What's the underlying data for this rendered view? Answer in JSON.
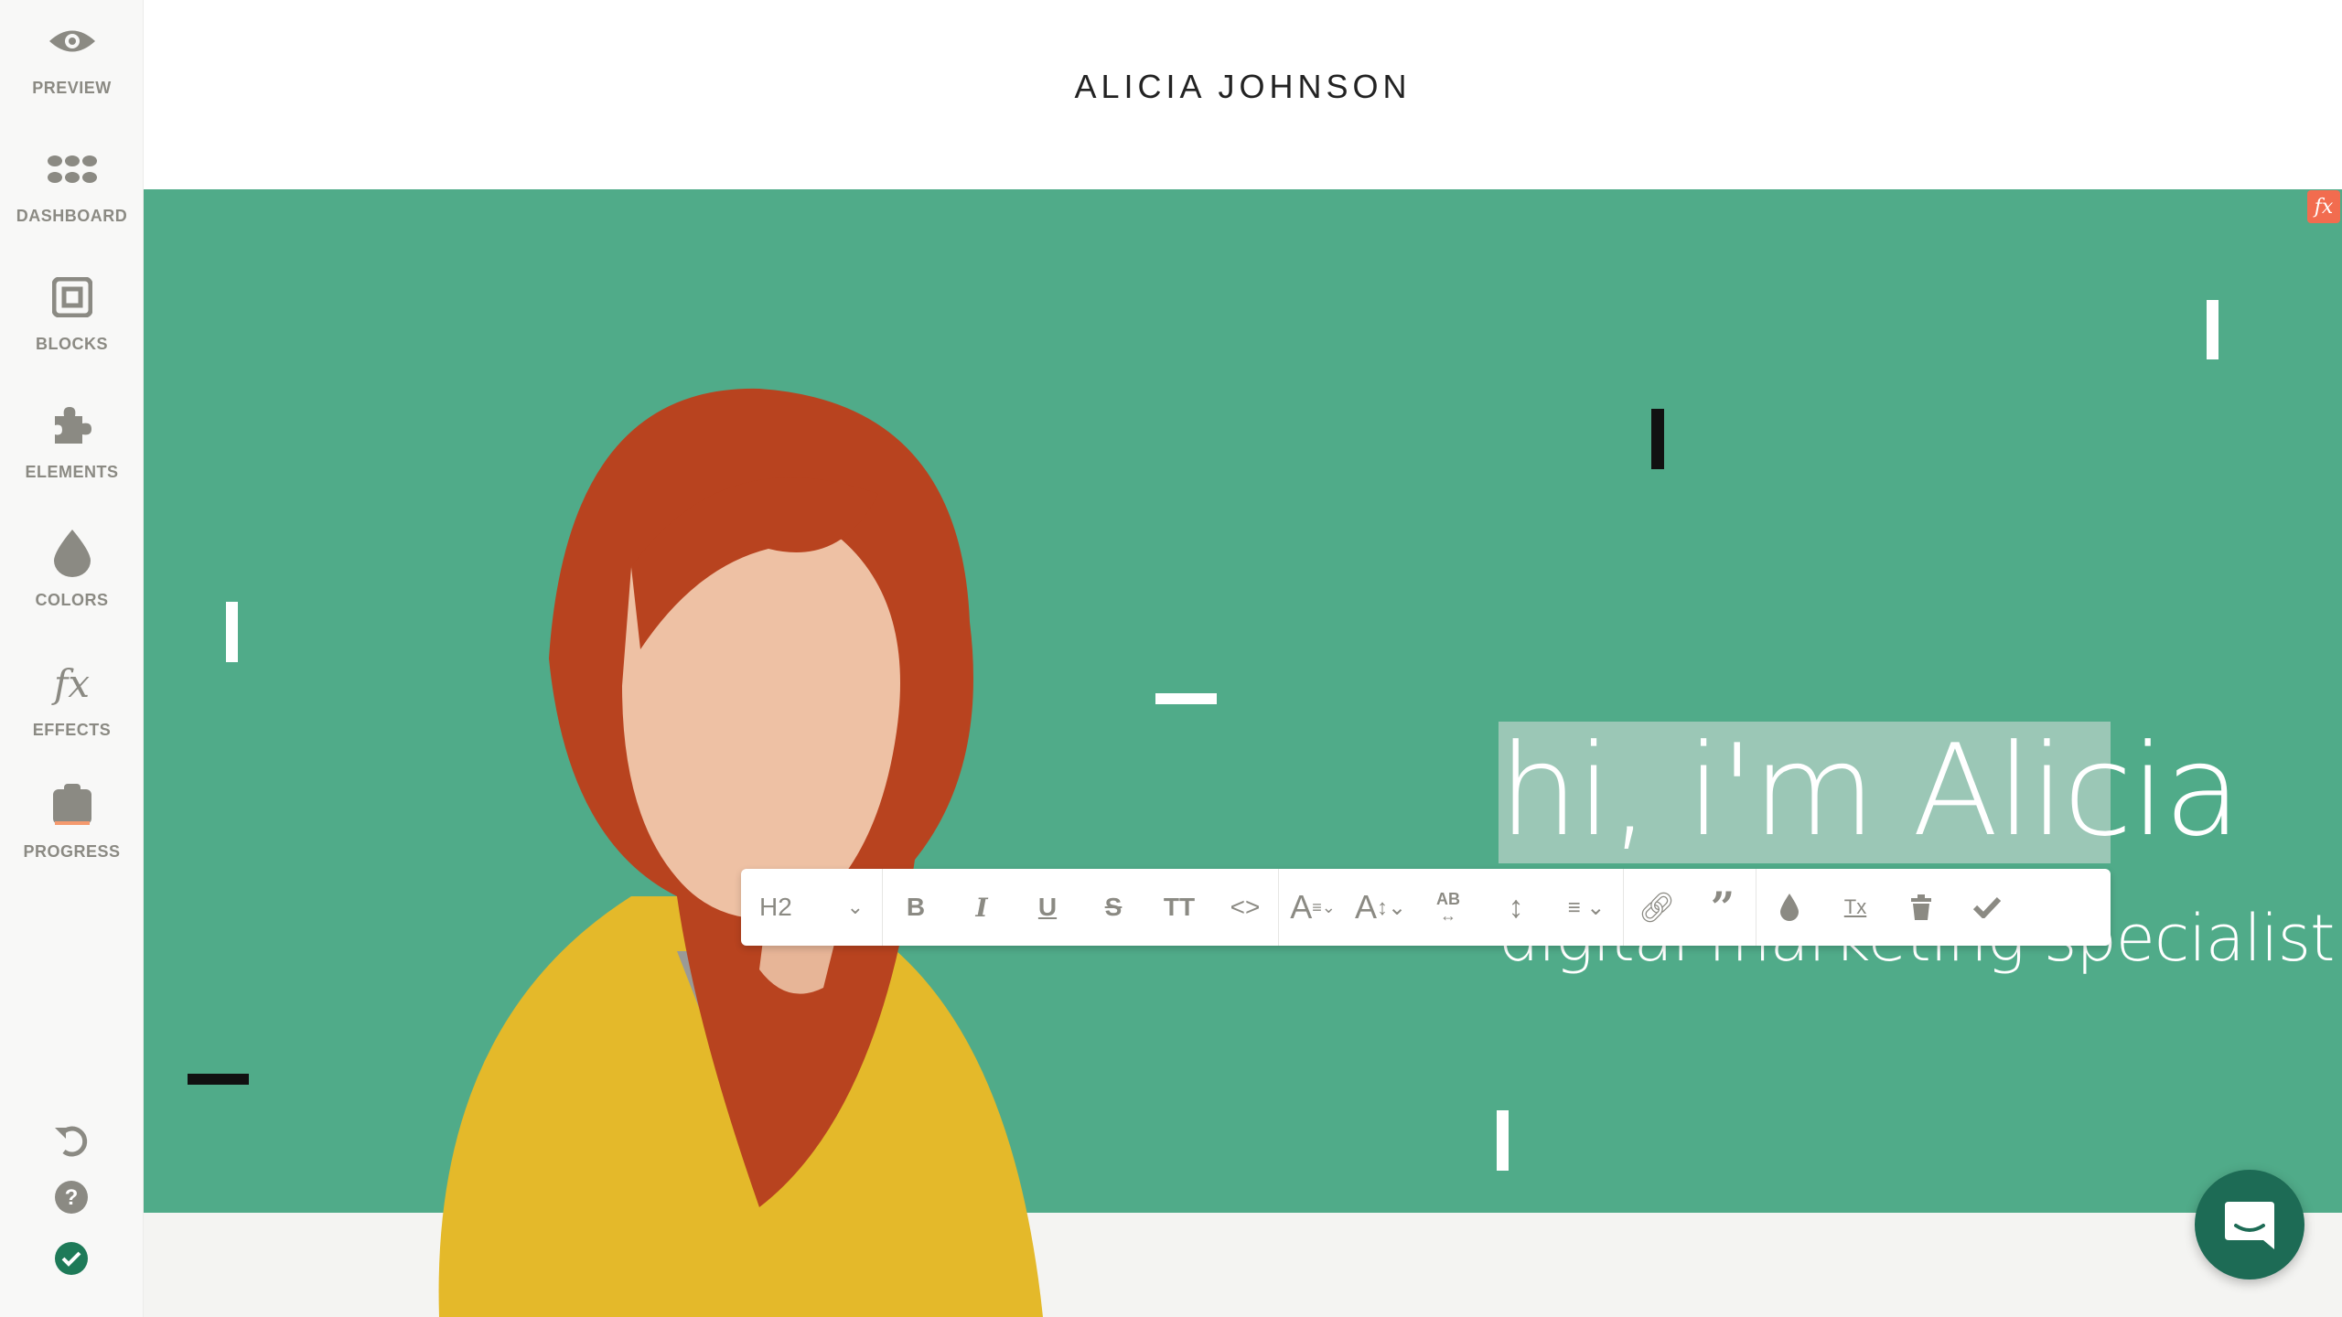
{
  "sidebar": {
    "items": [
      {
        "label": "PREVIEW",
        "icon": "eye-icon"
      },
      {
        "label": "DASHBOARD",
        "icon": "dots-grid-icon"
      },
      {
        "label": "BLOCKS",
        "icon": "block-square-icon"
      },
      {
        "label": "ELEMENTS",
        "icon": "puzzle-icon"
      },
      {
        "label": "COLORS",
        "icon": "droplet-icon"
      },
      {
        "label": "EFFECTS",
        "icon": "fx-icon"
      },
      {
        "label": "PROGRESS",
        "icon": "progress-briefcase-icon"
      }
    ],
    "bottom": [
      "undo-icon",
      "help-icon",
      "check-circle-icon"
    ]
  },
  "header": {
    "title": "ALICIA JOHNSON"
  },
  "hero": {
    "heading": "hi, i'm Alicia",
    "subheading": "digital marketing specialist",
    "fx_badge": "fx",
    "background": "#50ab89"
  },
  "toolbar": {
    "heading_level": "H2",
    "bold": "B",
    "italic": "I",
    "underline": "U",
    "strike": "S",
    "caps": "TT",
    "code": "<>",
    "clear_format": "Tx"
  },
  "colors": {
    "accent": "#50ab89",
    "sidebar_icon": "#8b8a83",
    "progress": "#f59a6e",
    "chat": "#1d6b55",
    "success": "#1e7a58"
  }
}
